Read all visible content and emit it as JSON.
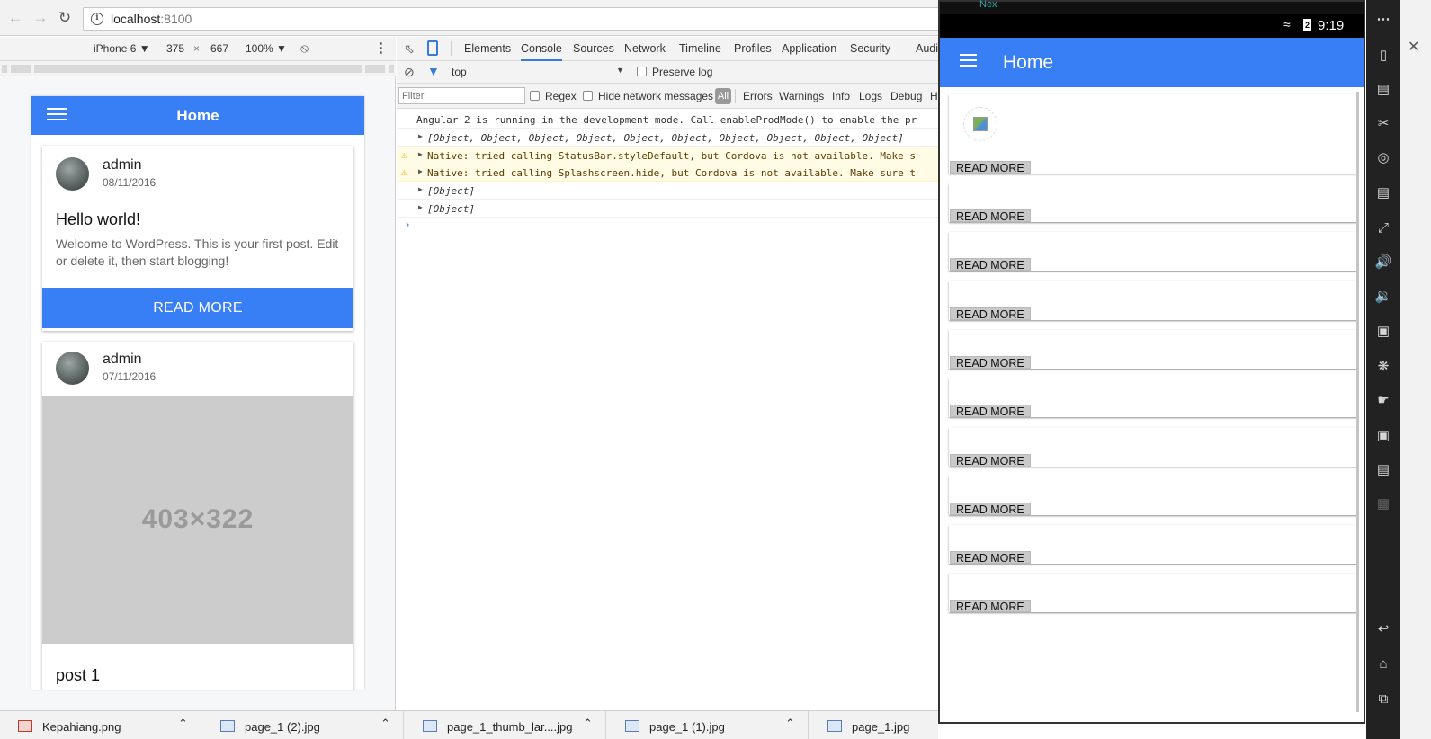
{
  "browser": {
    "url_host": "localhost",
    "url_port": ":8100"
  },
  "device_toolbar": {
    "device": "iPhone 6 ▼",
    "width": "375",
    "times": "×",
    "height": "667",
    "zoom": "100% ▼"
  },
  "preview": {
    "toolbar_title": "Home",
    "posts": [
      {
        "author": "admin",
        "date": "08/11/2016",
        "title": "Hello world!",
        "excerpt": "Welcome to WordPress. This is your first post. Edit or delete it, then start blogging!",
        "read_more": "READ MORE"
      },
      {
        "author": "admin",
        "date": "07/11/2016",
        "image_placeholder": "403×322",
        "title": "post 1"
      }
    ]
  },
  "devtools": {
    "tabs": [
      "Elements",
      "Console",
      "Sources",
      "Network",
      "Timeline",
      "Profiles",
      "Application",
      "Security",
      "Audits"
    ],
    "active_tab": "Console",
    "context": "top",
    "preserve_log": "Preserve log",
    "filter_placeholder": "Filter",
    "regex": "Regex",
    "hide_network": "Hide network messages",
    "levels": [
      "All",
      "Errors",
      "Warnings",
      "Info",
      "Logs",
      "Debug",
      "H"
    ],
    "console_lines": [
      {
        "kind": "log",
        "text": "Angular 2 is running in the development mode. Call enableProdMode() to enable the pr"
      },
      {
        "kind": "object",
        "text": "[Object, Object, Object, Object, Object, Object, Object, Object, Object, Object]"
      },
      {
        "kind": "warn",
        "text": "Native: tried calling StatusBar.styleDefault, but Cordova is not available. Make s"
      },
      {
        "kind": "warn",
        "text": "Native: tried calling Splashscreen.hide, but Cordova is not available. Make sure t"
      },
      {
        "kind": "object",
        "text": "[Object]"
      },
      {
        "kind": "object",
        "text": "[Object]"
      }
    ],
    "prompt": "›"
  },
  "emulator": {
    "title_fragment": "Nex",
    "status_time": "9:19",
    "battery_level": "2",
    "toolbar_title": "Home",
    "read_more": "READ MORE",
    "card_count": 10
  },
  "downloads": [
    {
      "name": "Kepahiang.png"
    },
    {
      "name": "page_1 (2).jpg"
    },
    {
      "name": "page_1_thumb_lar....jpg"
    },
    {
      "name": "page_1 (1).jpg"
    },
    {
      "name": "page_1.jpg"
    }
  ],
  "colors": {
    "ionic_primary": "#387ef5",
    "warning_bg": "#fffbe5",
    "devtools_active_tab": "#3879d9"
  }
}
